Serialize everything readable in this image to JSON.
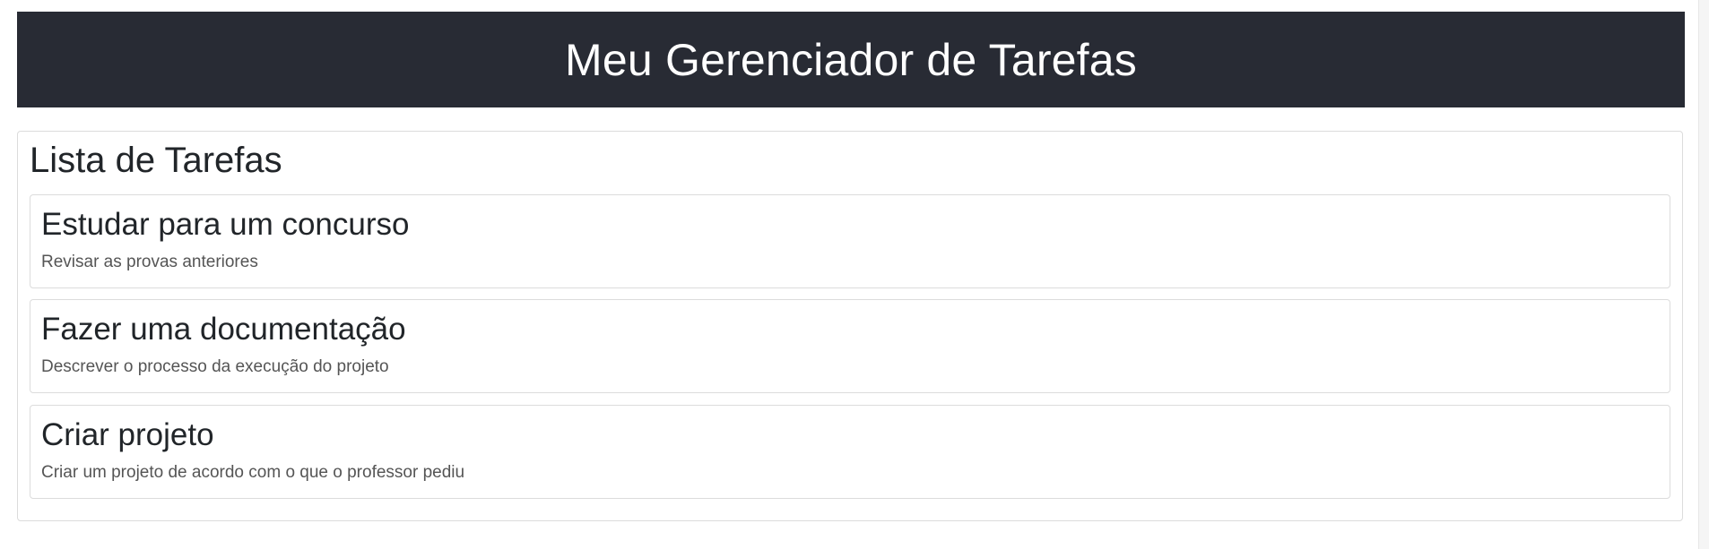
{
  "header": {
    "title": "Meu Gerenciador de Tarefas"
  },
  "task_list": {
    "title": "Lista de Tarefas",
    "tasks": [
      {
        "title": "Estudar para um concurso",
        "description": "Revisar as provas anteriores"
      },
      {
        "title": "Fazer uma documentação",
        "description": "Descrever o processo da execução do projeto"
      },
      {
        "title": "Criar projeto",
        "description": "Criar um projeto de acordo com o que o professor pediu"
      }
    ]
  },
  "colors": {
    "header_background": "#282b34",
    "header_text": "#ffffff",
    "card_border": "#dcdcdc",
    "description_text": "#555555"
  }
}
